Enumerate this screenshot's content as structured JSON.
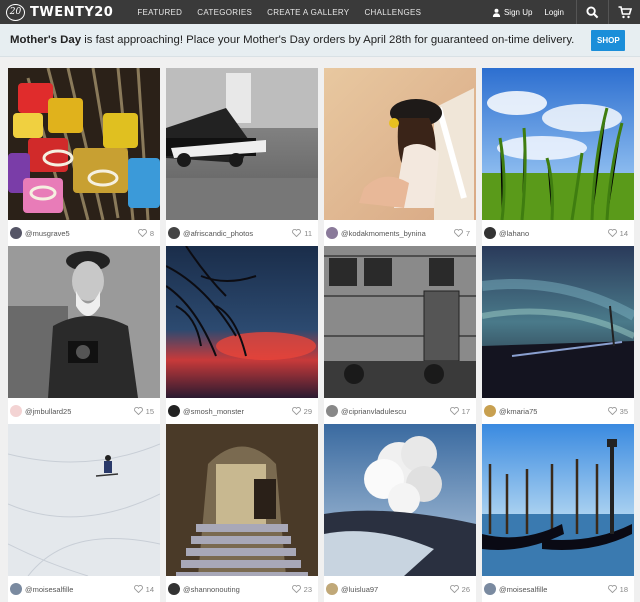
{
  "header": {
    "logo_badge": "20",
    "logo_text": "TWENTY20",
    "nav": [
      "FEATURED",
      "CATEGORIES",
      "CREATE A GALLERY",
      "CHALLENGES"
    ],
    "signup": "Sign Up",
    "login": "Login",
    "icons": [
      "user-icon",
      "search-icon",
      "cart-icon"
    ]
  },
  "banner": {
    "bold": "Mother's Day",
    "text": " is fast approaching! Place your Mother's Day orders by April 28th for guaranteed on-time delivery.",
    "button": "SHOP"
  },
  "photos": [
    {
      "user": "@musgrave5",
      "likes": "8"
    },
    {
      "user": "@afriscandic_photos",
      "likes": "11"
    },
    {
      "user": "@kodakmoments_bynina",
      "likes": "7"
    },
    {
      "user": "@lahano",
      "likes": "14"
    },
    {
      "user": "@jmbullard25",
      "likes": "15"
    },
    {
      "user": "@smosh_monster",
      "likes": "29"
    },
    {
      "user": "@ciprianvladulescu",
      "likes": "17"
    },
    {
      "user": "@kmaria75",
      "likes": "35"
    },
    {
      "user": "@moisesalfille",
      "likes": "14"
    },
    {
      "user": "@shannonouting",
      "likes": "23"
    },
    {
      "user": "@luisluа97",
      "likes": "26"
    },
    {
      "user": "@moisesalfille",
      "likes": "18"
    }
  ],
  "colors": {
    "topbar": "#3a3a3a",
    "banner": "#e7eef1",
    "shop_button": "#1b8ed9"
  }
}
